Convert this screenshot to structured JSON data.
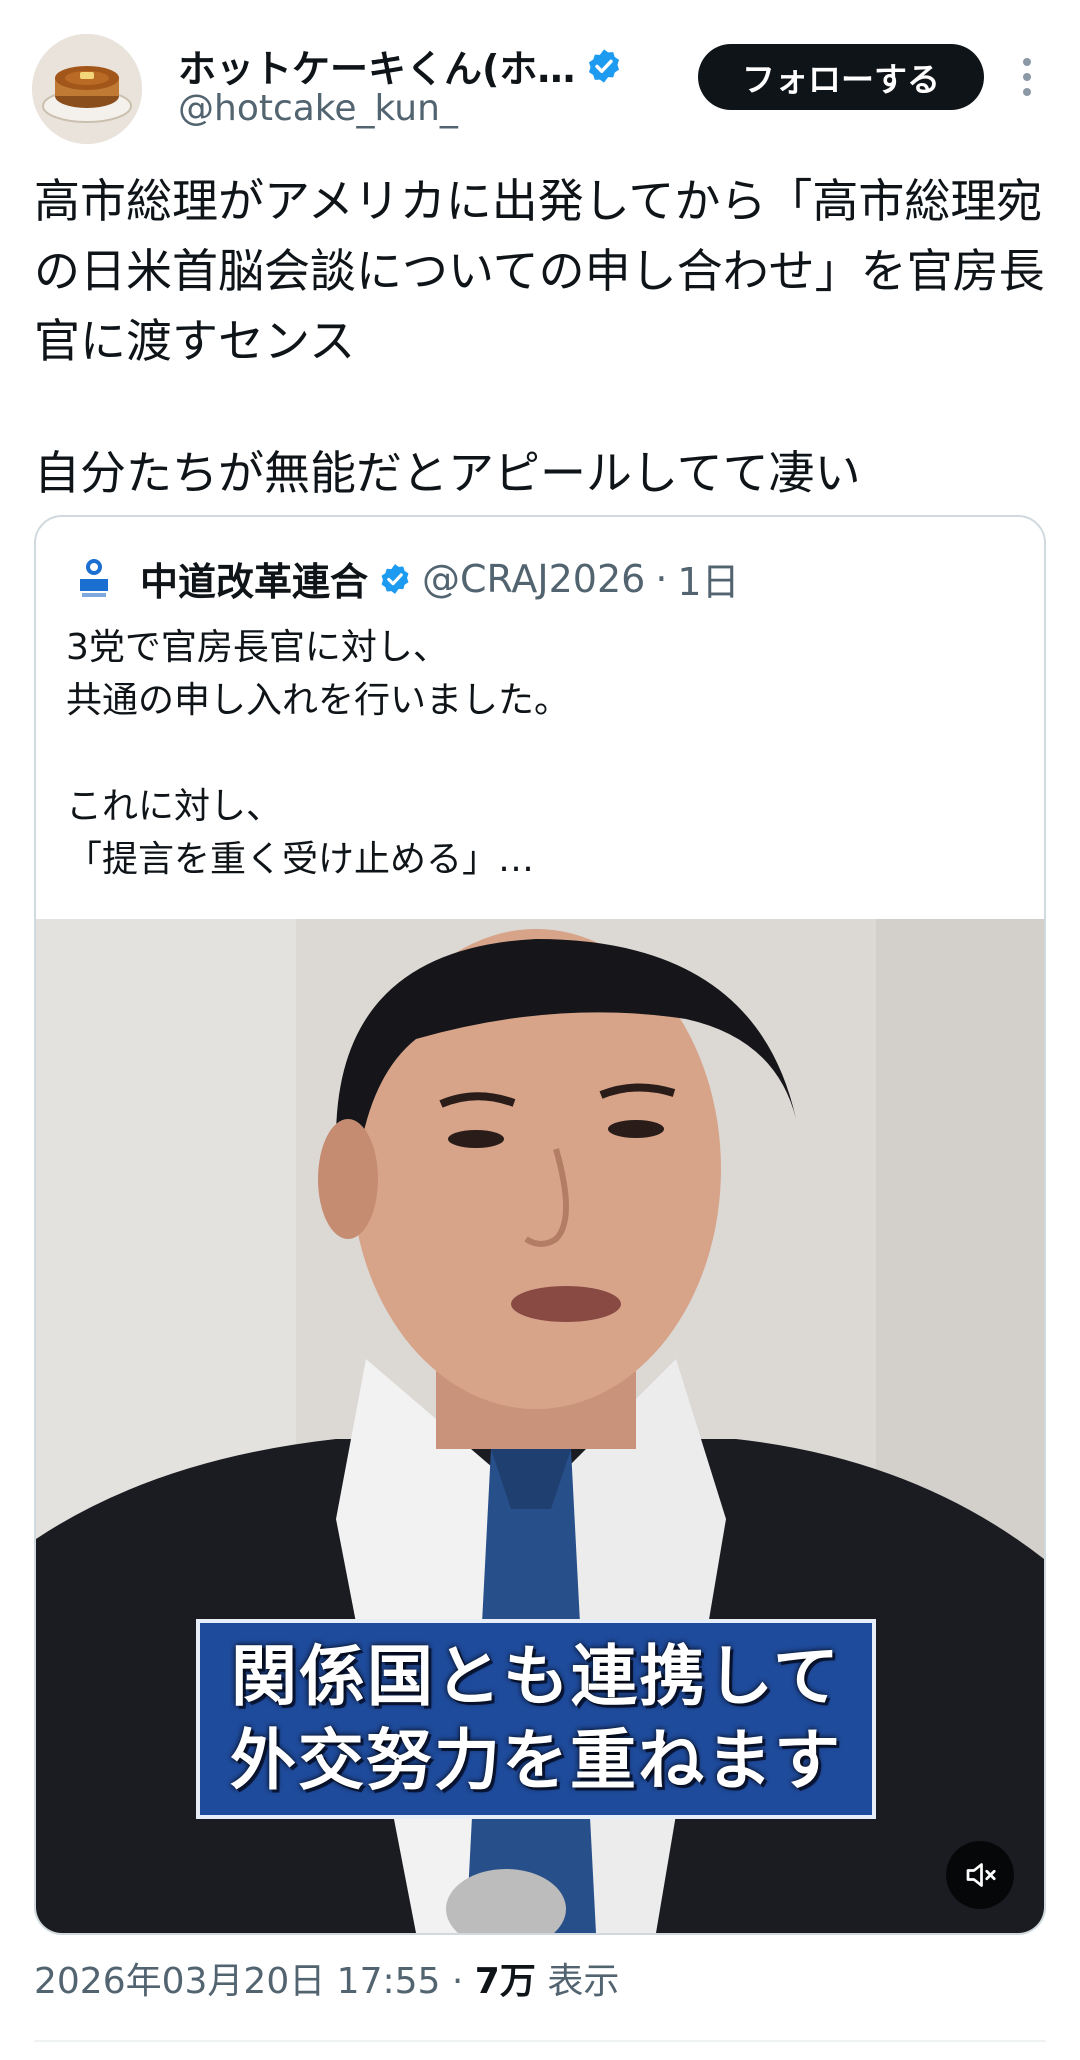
{
  "author": {
    "display_name": "ホットケーキくん(ホ…",
    "handle": "@hotcake_kun_",
    "verified_icon": "verified-badge-icon",
    "avatar_icon": "hotcake-avatar"
  },
  "actions": {
    "follow_label": "フォローする",
    "more_icon": "more-vertical-icon"
  },
  "tweet": {
    "paragraph1": "高市総理がアメリカに出発してから「高市総理宛の日米首脳会談についての申し合わせ」を官房長官に渡すセンス",
    "paragraph2": "自分たちが無能だとアピールしてて凄い"
  },
  "quote": {
    "display_name": "中道改革連合",
    "handle": "@CRAJ2026",
    "separator": "·",
    "time": "1日",
    "text_lines": [
      "3党で官房長官に対し、",
      "共通の申し入れを行いました。",
      "これに対し、",
      "「提言を重く受け止める」…"
    ],
    "media": {
      "caption_line1": "関係国とも連携して",
      "caption_line2": "外交努力を重ねます",
      "mute_icon": "speaker-muted-icon"
    }
  },
  "meta": {
    "timestamp": "2026年03月20日 17:55",
    "separator": "·",
    "views_count": "7万",
    "views_label": "表示"
  },
  "colors": {
    "text_primary": "#0f1419",
    "text_secondary": "#536471",
    "verified_blue": "#1d9bf0",
    "border": "#cfd9de",
    "caption_bg": "#1f4b9c"
  }
}
